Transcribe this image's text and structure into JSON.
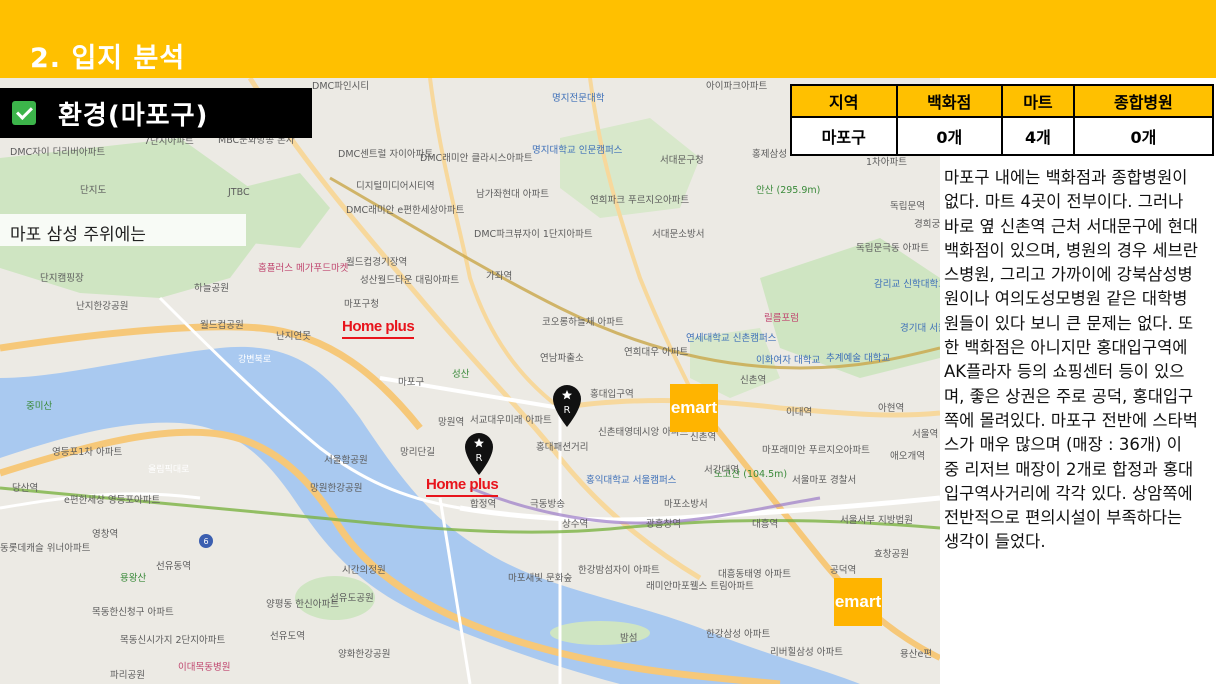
{
  "page": {
    "title": "2. 입지 분석"
  },
  "section": {
    "title": "환경(마포구)",
    "icon": "checkbox-checked-icon"
  },
  "caption_left": "마포 삼성 주위에는",
  "stat_table": {
    "headers": [
      "지역",
      "백화점",
      "마트",
      "종합병원"
    ],
    "rows": [
      [
        "마포구",
        "0개",
        "4개",
        "0개"
      ]
    ]
  },
  "description": "마포구 내에는 백화점과 종합병원이 없다. 마트 4곳이 전부이다. 그러나 바로 옆 신촌역 근처 서대문구에 현대백화점이 있으며, 병원의 경우 세브란스병원, 그리고 가까이에 강북삼성병원이나 여의도성모병원 같은 대학병원들이 있다 보니 큰 문제는 없다. 또한 백화점은 아니지만 홍대입구역에 AK플라자 등의 쇼핑센터 등이 있으며, 좋은 상권은 주로 공덕, 홍대입구 쪽에 몰려있다. 마포구 전반에 스타벅스가 매우 많으며 (매장 : 36개) 이 중 리저브 매장이 2개로 합정과 홍대입구역사거리에 각각 있다. 상암쪽에 전반적으로 편의시설이 부족하다는 생각이 들었다.",
  "brands": {
    "homeplus": "Home plus",
    "emart": "emart",
    "reserve_mark": "R"
  },
  "colors": {
    "accent": "#ffc000",
    "homeplus": "#e8141c",
    "emart": "#ffb400",
    "river": "#a9c9f0",
    "park": "#cfe5c2"
  },
  "map_labels": [
    {
      "text": "DMC파인시티",
      "cls": ""
    },
    {
      "text": "명지전문대학",
      "cls": "blue"
    },
    {
      "text": "아이파크아파트",
      "cls": ""
    },
    {
      "text": "7단지아파트",
      "cls": ""
    },
    {
      "text": "MBC문화방송 본사",
      "cls": ""
    },
    {
      "text": "DMC자이 더리버아파트",
      "cls": ""
    },
    {
      "text": "DMC센트럴 자이아파트",
      "cls": ""
    },
    {
      "text": "DMC래미안 클라시스아파트",
      "cls": ""
    },
    {
      "text": "명지대학교 인문캠퍼스",
      "cls": "blue"
    },
    {
      "text": "서대문구청",
      "cls": ""
    },
    {
      "text": "홍제삼성",
      "cls": ""
    },
    {
      "text": "1차아파트",
      "cls": ""
    },
    {
      "text": "단지도",
      "cls": ""
    },
    {
      "text": "JTBC",
      "cls": ""
    },
    {
      "text": "디지털미디어시티역",
      "cls": ""
    },
    {
      "text": "남가좌현대 아파트",
      "cls": ""
    },
    {
      "text": "연희파크 푸르지오아파트",
      "cls": ""
    },
    {
      "text": "안산 (295.9m)",
      "cls": "green"
    },
    {
      "text": "독립문역",
      "cls": ""
    },
    {
      "text": "DMC래미안 e편한세상아파트",
      "cls": ""
    },
    {
      "text": "DMC파크뷰자이 1단지아파트",
      "cls": ""
    },
    {
      "text": "서대문소방서",
      "cls": ""
    },
    {
      "text": "독립문극동 아파트",
      "cls": ""
    },
    {
      "text": "월드컵경기장역",
      "cls": ""
    },
    {
      "text": "가좌역",
      "cls": ""
    },
    {
      "text": "단지캠핑장",
      "cls": ""
    },
    {
      "text": "홈플러스 메가푸드마켓",
      "cls": "pink"
    },
    {
      "text": "성산월드타운 대림아파트",
      "cls": ""
    },
    {
      "text": "감리교 신학대학교",
      "cls": "blue"
    },
    {
      "text": "하늘공원",
      "cls": ""
    },
    {
      "text": "난지한강공원",
      "cls": ""
    },
    {
      "text": "월드컵공원",
      "cls": ""
    },
    {
      "text": "마포구청",
      "cls": ""
    },
    {
      "text": "코오롱하늘채 아파트",
      "cls": ""
    },
    {
      "text": "릴름포럼",
      "cls": "pink"
    },
    {
      "text": "경기대 서울캠",
      "cls": "blue"
    },
    {
      "text": "난지연못",
      "cls": ""
    },
    {
      "text": "강변북로",
      "cls": "road"
    },
    {
      "text": "성산",
      "cls": "green"
    },
    {
      "text": "연남파출소",
      "cls": ""
    },
    {
      "text": "연희대우 아파트",
      "cls": ""
    },
    {
      "text": "연세대학교 신촌캠퍼스",
      "cls": "blue"
    },
    {
      "text": "이화여자 대학교",
      "cls": "blue"
    },
    {
      "text": "추계예술 대학교",
      "cls": "blue"
    },
    {
      "text": "마포구",
      "cls": ""
    },
    {
      "text": "홍대입구역",
      "cls": ""
    },
    {
      "text": "신촌역",
      "cls": ""
    },
    {
      "text": "중미산",
      "cls": "green"
    },
    {
      "text": "망원역",
      "cls": ""
    },
    {
      "text": "서교대우미래 아파트",
      "cls": ""
    },
    {
      "text": "신촌태영데시앙 아파트",
      "cls": ""
    },
    {
      "text": "이대역",
      "cls": ""
    },
    {
      "text": "아현역",
      "cls": ""
    },
    {
      "text": "영등포1차 아파트",
      "cls": ""
    },
    {
      "text": "망리단길",
      "cls": ""
    },
    {
      "text": "홍대패션거리",
      "cls": ""
    },
    {
      "text": "신촌역",
      "cls": ""
    },
    {
      "text": "마포래미안 푸르지오아파트",
      "cls": ""
    },
    {
      "text": "애오개역",
      "cls": ""
    },
    {
      "text": "서울함공원",
      "cls": ""
    },
    {
      "text": "서강대역",
      "cls": ""
    },
    {
      "text": "노고산 (104.5m)",
      "cls": "green"
    },
    {
      "text": "당산역",
      "cls": ""
    },
    {
      "text": "망원한강공원",
      "cls": ""
    },
    {
      "text": "올림픽대로",
      "cls": "road"
    },
    {
      "text": "홍익대학교 서울캠퍼스",
      "cls": "blue"
    },
    {
      "text": "서울마포 경찰서",
      "cls": ""
    },
    {
      "text": "e편한세상 영등포아파트",
      "cls": ""
    },
    {
      "text": "합정역",
      "cls": ""
    },
    {
      "text": "극동방송",
      "cls": ""
    },
    {
      "text": "마포소방서",
      "cls": ""
    },
    {
      "text": "영창역",
      "cls": ""
    },
    {
      "text": "상수역",
      "cls": ""
    },
    {
      "text": "광흥창역",
      "cls": ""
    },
    {
      "text": "대흥역",
      "cls": ""
    },
    {
      "text": "서울서부 지방법원",
      "cls": ""
    },
    {
      "text": "효창공원",
      "cls": ""
    },
    {
      "text": "동롯데캐슬 위너아파트",
      "cls": ""
    },
    {
      "text": "선유동역",
      "cls": ""
    },
    {
      "text": "시간의정원",
      "cls": ""
    },
    {
      "text": "한강밤섬자이 아파트",
      "cls": ""
    },
    {
      "text": "대흥동태영 아파트",
      "cls": ""
    },
    {
      "text": "공덕역",
      "cls": ""
    },
    {
      "text": "용왕산",
      "cls": "green"
    },
    {
      "text": "선유도공원",
      "cls": ""
    },
    {
      "text": "마포새빛 문화숲",
      "cls": ""
    },
    {
      "text": "래미안마포웰스 트림아파트",
      "cls": ""
    },
    {
      "text": "목동한신청구 아파트",
      "cls": ""
    },
    {
      "text": "양평동 한신아파트",
      "cls": ""
    },
    {
      "text": "밤섬",
      "cls": ""
    },
    {
      "text": "한강삼성 아파트",
      "cls": ""
    },
    {
      "text": "목동신시가지 2단지아파트",
      "cls": ""
    },
    {
      "text": "선유도역",
      "cls": ""
    },
    {
      "text": "양화한강공원",
      "cls": ""
    },
    {
      "text": "리버힐삼성 아파트",
      "cls": ""
    },
    {
      "text": "이대목동병원",
      "cls": "pink"
    },
    {
      "text": "파리공원",
      "cls": ""
    },
    {
      "text": "용산e편",
      "cls": ""
    },
    {
      "text": "경희궁",
      "cls": ""
    },
    {
      "text": "서울역",
      "cls": ""
    }
  ]
}
